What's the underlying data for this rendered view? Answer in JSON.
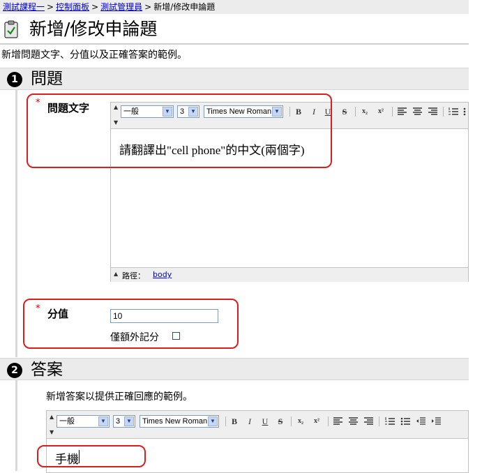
{
  "breadcrumb": {
    "items": [
      "測試課程一",
      "控制面板",
      "測試管理員"
    ],
    "current": "新增/修改申論題",
    "separator": ">"
  },
  "page": {
    "title": "新增/修改申論題",
    "description": "新增問題文字、分值以及正確答案的範例。"
  },
  "section1": {
    "number": "1",
    "title": "問題",
    "question_label": "問題文字",
    "required_mark": "*",
    "editor": {
      "format": "一般",
      "size": "3",
      "font": "Times New Roman",
      "content": "請翻譯出\"cell phone\"的中文(兩個字)",
      "path_label": "路徑：",
      "path_value": "body"
    },
    "points_label": "分值",
    "points_value": "10",
    "extra_credit_label": "僅額外記分"
  },
  "section2": {
    "number": "2",
    "title": "答案",
    "description": "新增答案以提供正確回應的範例。",
    "editor": {
      "format": "一般",
      "size": "3",
      "font": "Times New Roman",
      "content": "手機"
    }
  },
  "toolbar": {
    "bold": "B",
    "italic": "I",
    "underline": "U",
    "strike": "S",
    "subscript": "x₂",
    "superscript": "x²"
  },
  "colors": {
    "highlight": "#d91e1e",
    "link": "#0000cc",
    "required": "#d40000",
    "section_bar": "#ebebeb"
  }
}
